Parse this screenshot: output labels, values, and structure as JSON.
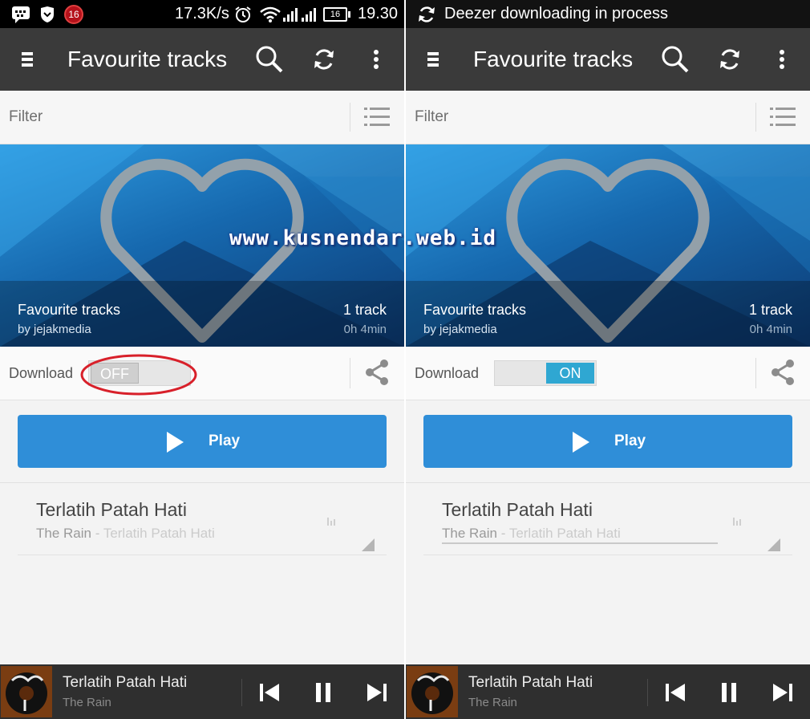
{
  "panels": {
    "left": {
      "status_bar": {
        "network_speed": "17.3K/s",
        "battery": "16",
        "time": "19.30",
        "notification_count": "16"
      },
      "toolbar": {
        "title": "Favourite tracks"
      },
      "filter": {
        "placeholder": "Filter"
      },
      "playlist": {
        "title": "Favourite tracks",
        "owner": "by jejakmedia",
        "track_count": "1 track",
        "duration": "0h 4min"
      },
      "download": {
        "label": "Download",
        "toggle_text": "OFF",
        "state": "off"
      },
      "play_button": {
        "label": "Play"
      },
      "tracks": [
        {
          "title": "Terlatih Patah Hati",
          "artist": "The Rain",
          "separator": "-",
          "album": "Terlatih Patah Hati"
        }
      ],
      "now_playing": {
        "title": "Terlatih Patah Hati",
        "artist": "The Rain"
      }
    },
    "right": {
      "status_bar": {
        "notification_text": "Deezer downloading in process"
      },
      "toolbar": {
        "title": "Favourite tracks"
      },
      "filter": {
        "placeholder": "Filter"
      },
      "playlist": {
        "title": "Favourite tracks",
        "owner": "by jejakmedia",
        "track_count": "1 track",
        "duration": "0h 4min"
      },
      "download": {
        "label": "Download",
        "toggle_text": "ON",
        "state": "on"
      },
      "play_button": {
        "label": "Play"
      },
      "tracks": [
        {
          "title": "Terlatih Patah Hati",
          "artist": "The Rain",
          "separator": "-",
          "album": "Terlatih Patah Hati"
        }
      ],
      "now_playing": {
        "title": "Terlatih Patah Hati",
        "artist": "The Rain"
      }
    }
  },
  "watermark": {
    "text": "www.kusnendar.web.id"
  },
  "colors": {
    "toolbar": "#3a3a3a",
    "play_button": "#2f8ed8",
    "toggle_on": "#2fa7d2",
    "highlight_circle": "#d8202a"
  }
}
